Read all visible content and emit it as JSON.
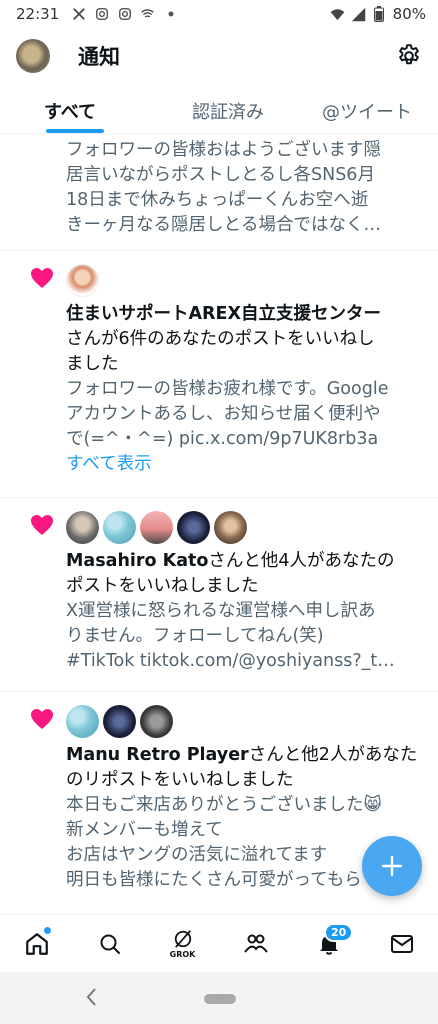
{
  "status_bar": {
    "time": "22:31",
    "battery": "80%"
  },
  "header": {
    "title": "通知"
  },
  "tabs": [
    {
      "label": "すべて",
      "active": true
    },
    {
      "label": "認証済み",
      "active": false
    },
    {
      "label": "@ツイート",
      "active": false
    }
  ],
  "notifications": [
    {
      "body": [
        "フォロワーの皆様おはようございます隠",
        "居言いながらポストしとるし各SNS6月",
        "18日まで休みちょっぱーくんお空へ逝",
        "きーヶ月なる隠居しとる場合ではなく…"
      ]
    },
    {
      "actor": "住まいサポートAREX自立支援センター",
      "action": "さんが6件のあなたのポストをいいねし",
      "action2": "ました",
      "body": [
        "フォロワーの皆様お疲れ様です。Google",
        "アカウントあるし、お知らせ届く便利や",
        "で(=^・^=) pic.x.com/9p7UK8rb3a"
      ],
      "show_all": "すべて表示"
    },
    {
      "actor": "Masahiro Kato",
      "action": "さんと他4人があなたの",
      "action2": "ポストをいいねしました",
      "body": [
        "X運営様に怒られるな運営様へ申し訳あ",
        "りません。フォローしてねん(笑)",
        "#TikTok tiktok.com/@yoshiyanss?_t…"
      ]
    },
    {
      "actor": "Manu Retro Player",
      "action": "さんと他2人があなた",
      "action2": "のリポストをいいねしました",
      "body": [
        "本日もご来店ありがとうございました😸",
        "新メンバーも増えて",
        "お店はヤングの活気に溢れてます",
        "明日も皆様にたくさん可愛がってもら"
      ]
    }
  ],
  "bottom_nav": {
    "grok_label": "GROK",
    "notification_count": "20"
  },
  "colors": {
    "accent": "#1d9bf0",
    "like": "#f91880",
    "muted": "#536471"
  }
}
